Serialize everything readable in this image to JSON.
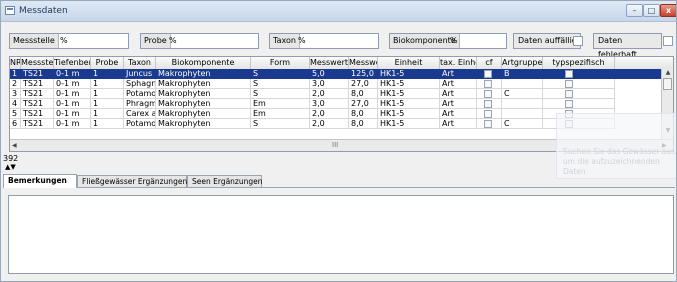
{
  "window": {
    "title": "Messdaten"
  },
  "filters": [
    {
      "label": "Messstelle",
      "value": "%"
    },
    {
      "label": "Probe",
      "value": "%"
    },
    {
      "label": "Taxon",
      "value": "%"
    },
    {
      "label": "Biokomponente",
      "value": "%"
    }
  ],
  "checks": {
    "auffaellig_label": "Daten auffällig",
    "fehlerhaft_label": "Daten fehlerhaft"
  },
  "grid": {
    "columns": [
      "NR",
      "Messstelle",
      "Tiefenbereich",
      "Probe",
      "Taxon",
      "Biokomponente",
      "Form",
      "Messwert",
      "Messwert berechnet",
      "Einheit",
      "tax. Einheit",
      "cf",
      "Artgruppe",
      "typspezifisch"
    ],
    "rows": [
      {
        "nr": "1",
        "messstelle": "TS21",
        "tiefe": "0-1 m",
        "probe": "1",
        "taxon": "Juncus bulbosus",
        "biokomp": "Makrophyten",
        "form": "S",
        "messwert": "5,0",
        "berechnet": "125,0",
        "einheit": "HK1-5",
        "taxeinheit": "Art",
        "artgruppe": "B",
        "selected": true
      },
      {
        "nr": "2",
        "messstelle": "TS21",
        "tiefe": "0-1 m",
        "probe": "1",
        "taxon": "Sphagnum obtusum",
        "biokomp": "Makrophyten",
        "form": "S",
        "messwert": "3,0",
        "berechnet": "27,0",
        "einheit": "HK1-5",
        "taxeinheit": "Art",
        "artgruppe": ""
      },
      {
        "nr": "3",
        "messstelle": "TS21",
        "tiefe": "0-1 m",
        "probe": "1",
        "taxon": "Potamogeton pectinatus",
        "biokomp": "Makrophyten",
        "form": "S",
        "messwert": "2,0",
        "berechnet": "8,0",
        "einheit": "HK1-5",
        "taxeinheit": "Art",
        "artgruppe": "C"
      },
      {
        "nr": "4",
        "messstelle": "TS21",
        "tiefe": "0-1 m",
        "probe": "1",
        "taxon": "Phragmites australis",
        "biokomp": "Makrophyten",
        "form": "Em",
        "messwert": "3,0",
        "berechnet": "27,0",
        "einheit": "HK1-5",
        "taxeinheit": "Art",
        "artgruppe": ""
      },
      {
        "nr": "5",
        "messstelle": "TS21",
        "tiefe": "0-1 m",
        "probe": "1",
        "taxon": "Carex acuta",
        "biokomp": "Makrophyten",
        "form": "Em",
        "messwert": "2,0",
        "berechnet": "8,0",
        "einheit": "HK1-5",
        "taxeinheit": "Art",
        "artgruppe": ""
      },
      {
        "nr": "6",
        "messstelle": "TS21",
        "tiefe": "0-1 m",
        "probe": "1",
        "taxon": "Potamogeton pusillus",
        "biokomp": "Makrophyten",
        "form": "S",
        "messwert": "2,0",
        "berechnet": "8,0",
        "einheit": "HK1-5",
        "taxeinheit": "Art",
        "artgruppe": "C"
      }
    ]
  },
  "record_count": "392",
  "tabs": [
    "Bemerkungen",
    "Fließgewässer Ergänzungen",
    "Seen Ergänzungen"
  ],
  "ghost_text": "Suchen Sie das Gewässer aus, um die aufzuzeichnenden Daten",
  "colors": {
    "selection": "#1a3a8f",
    "title_text": "#1e395b"
  }
}
